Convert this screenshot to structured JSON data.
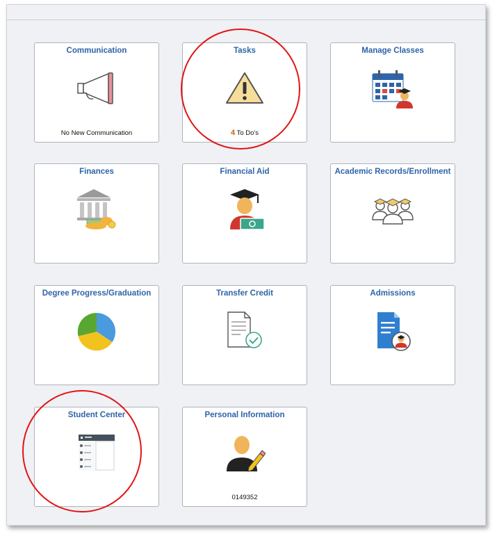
{
  "tiles": {
    "communication": {
      "title": "Communication",
      "footer": "No New Communication"
    },
    "tasks": {
      "title": "Tasks",
      "count": "4",
      "footer": "To Do's"
    },
    "manage_classes": {
      "title": "Manage Classes"
    },
    "finances": {
      "title": "Finances"
    },
    "financial_aid": {
      "title": "Financial Aid"
    },
    "academic_records": {
      "title": "Academic Records/Enrollment"
    },
    "degree_progress": {
      "title": "Degree Progress/Graduation"
    },
    "transfer_credit": {
      "title": "Transfer Credit"
    },
    "admissions": {
      "title": "Admissions"
    },
    "student_center": {
      "title": "Student Center"
    },
    "personal_information": {
      "title": "Personal Information",
      "footer": "0149352"
    }
  },
  "annotations": {
    "highlight_color": "#e01414"
  },
  "colors": {
    "title_blue": "#2e64a8",
    "count_orange": "#c8641a"
  }
}
